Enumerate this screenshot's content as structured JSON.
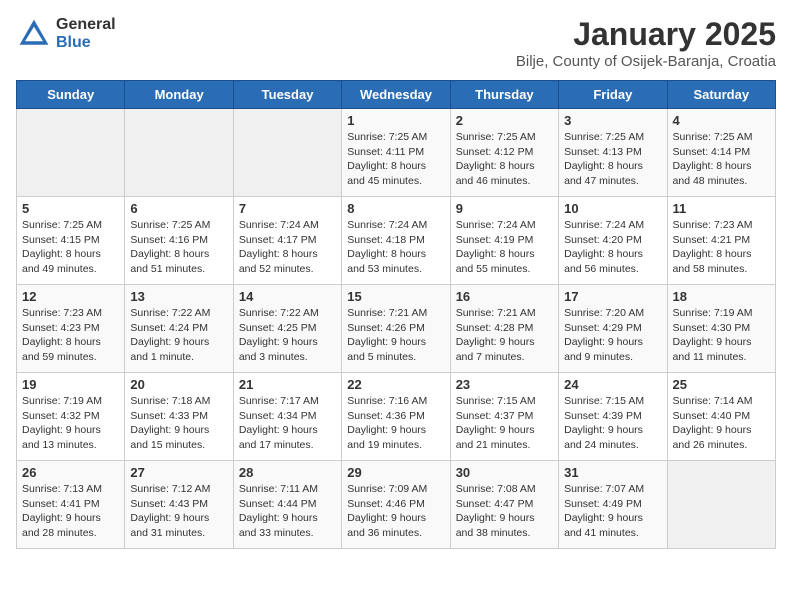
{
  "logo": {
    "general": "General",
    "blue": "Blue"
  },
  "header": {
    "title": "January 2025",
    "subtitle": "Bilje, County of Osijek-Baranja, Croatia"
  },
  "weekdays": [
    "Sunday",
    "Monday",
    "Tuesday",
    "Wednesday",
    "Thursday",
    "Friday",
    "Saturday"
  ],
  "weeks": [
    [
      {
        "day": "",
        "info": ""
      },
      {
        "day": "",
        "info": ""
      },
      {
        "day": "",
        "info": ""
      },
      {
        "day": "1",
        "info": "Sunrise: 7:25 AM\nSunset: 4:11 PM\nDaylight: 8 hours and 45 minutes."
      },
      {
        "day": "2",
        "info": "Sunrise: 7:25 AM\nSunset: 4:12 PM\nDaylight: 8 hours and 46 minutes."
      },
      {
        "day": "3",
        "info": "Sunrise: 7:25 AM\nSunset: 4:13 PM\nDaylight: 8 hours and 47 minutes."
      },
      {
        "day": "4",
        "info": "Sunrise: 7:25 AM\nSunset: 4:14 PM\nDaylight: 8 hours and 48 minutes."
      }
    ],
    [
      {
        "day": "5",
        "info": "Sunrise: 7:25 AM\nSunset: 4:15 PM\nDaylight: 8 hours and 49 minutes."
      },
      {
        "day": "6",
        "info": "Sunrise: 7:25 AM\nSunset: 4:16 PM\nDaylight: 8 hours and 51 minutes."
      },
      {
        "day": "7",
        "info": "Sunrise: 7:24 AM\nSunset: 4:17 PM\nDaylight: 8 hours and 52 minutes."
      },
      {
        "day": "8",
        "info": "Sunrise: 7:24 AM\nSunset: 4:18 PM\nDaylight: 8 hours and 53 minutes."
      },
      {
        "day": "9",
        "info": "Sunrise: 7:24 AM\nSunset: 4:19 PM\nDaylight: 8 hours and 55 minutes."
      },
      {
        "day": "10",
        "info": "Sunrise: 7:24 AM\nSunset: 4:20 PM\nDaylight: 8 hours and 56 minutes."
      },
      {
        "day": "11",
        "info": "Sunrise: 7:23 AM\nSunset: 4:21 PM\nDaylight: 8 hours and 58 minutes."
      }
    ],
    [
      {
        "day": "12",
        "info": "Sunrise: 7:23 AM\nSunset: 4:23 PM\nDaylight: 8 hours and 59 minutes."
      },
      {
        "day": "13",
        "info": "Sunrise: 7:22 AM\nSunset: 4:24 PM\nDaylight: 9 hours and 1 minute."
      },
      {
        "day": "14",
        "info": "Sunrise: 7:22 AM\nSunset: 4:25 PM\nDaylight: 9 hours and 3 minutes."
      },
      {
        "day": "15",
        "info": "Sunrise: 7:21 AM\nSunset: 4:26 PM\nDaylight: 9 hours and 5 minutes."
      },
      {
        "day": "16",
        "info": "Sunrise: 7:21 AM\nSunset: 4:28 PM\nDaylight: 9 hours and 7 minutes."
      },
      {
        "day": "17",
        "info": "Sunrise: 7:20 AM\nSunset: 4:29 PM\nDaylight: 9 hours and 9 minutes."
      },
      {
        "day": "18",
        "info": "Sunrise: 7:19 AM\nSunset: 4:30 PM\nDaylight: 9 hours and 11 minutes."
      }
    ],
    [
      {
        "day": "19",
        "info": "Sunrise: 7:19 AM\nSunset: 4:32 PM\nDaylight: 9 hours and 13 minutes."
      },
      {
        "day": "20",
        "info": "Sunrise: 7:18 AM\nSunset: 4:33 PM\nDaylight: 9 hours and 15 minutes."
      },
      {
        "day": "21",
        "info": "Sunrise: 7:17 AM\nSunset: 4:34 PM\nDaylight: 9 hours and 17 minutes."
      },
      {
        "day": "22",
        "info": "Sunrise: 7:16 AM\nSunset: 4:36 PM\nDaylight: 9 hours and 19 minutes."
      },
      {
        "day": "23",
        "info": "Sunrise: 7:15 AM\nSunset: 4:37 PM\nDaylight: 9 hours and 21 minutes."
      },
      {
        "day": "24",
        "info": "Sunrise: 7:15 AM\nSunset: 4:39 PM\nDaylight: 9 hours and 24 minutes."
      },
      {
        "day": "25",
        "info": "Sunrise: 7:14 AM\nSunset: 4:40 PM\nDaylight: 9 hours and 26 minutes."
      }
    ],
    [
      {
        "day": "26",
        "info": "Sunrise: 7:13 AM\nSunset: 4:41 PM\nDaylight: 9 hours and 28 minutes."
      },
      {
        "day": "27",
        "info": "Sunrise: 7:12 AM\nSunset: 4:43 PM\nDaylight: 9 hours and 31 minutes."
      },
      {
        "day": "28",
        "info": "Sunrise: 7:11 AM\nSunset: 4:44 PM\nDaylight: 9 hours and 33 minutes."
      },
      {
        "day": "29",
        "info": "Sunrise: 7:09 AM\nSunset: 4:46 PM\nDaylight: 9 hours and 36 minutes."
      },
      {
        "day": "30",
        "info": "Sunrise: 7:08 AM\nSunset: 4:47 PM\nDaylight: 9 hours and 38 minutes."
      },
      {
        "day": "31",
        "info": "Sunrise: 7:07 AM\nSunset: 4:49 PM\nDaylight: 9 hours and 41 minutes."
      },
      {
        "day": "",
        "info": ""
      }
    ]
  ]
}
